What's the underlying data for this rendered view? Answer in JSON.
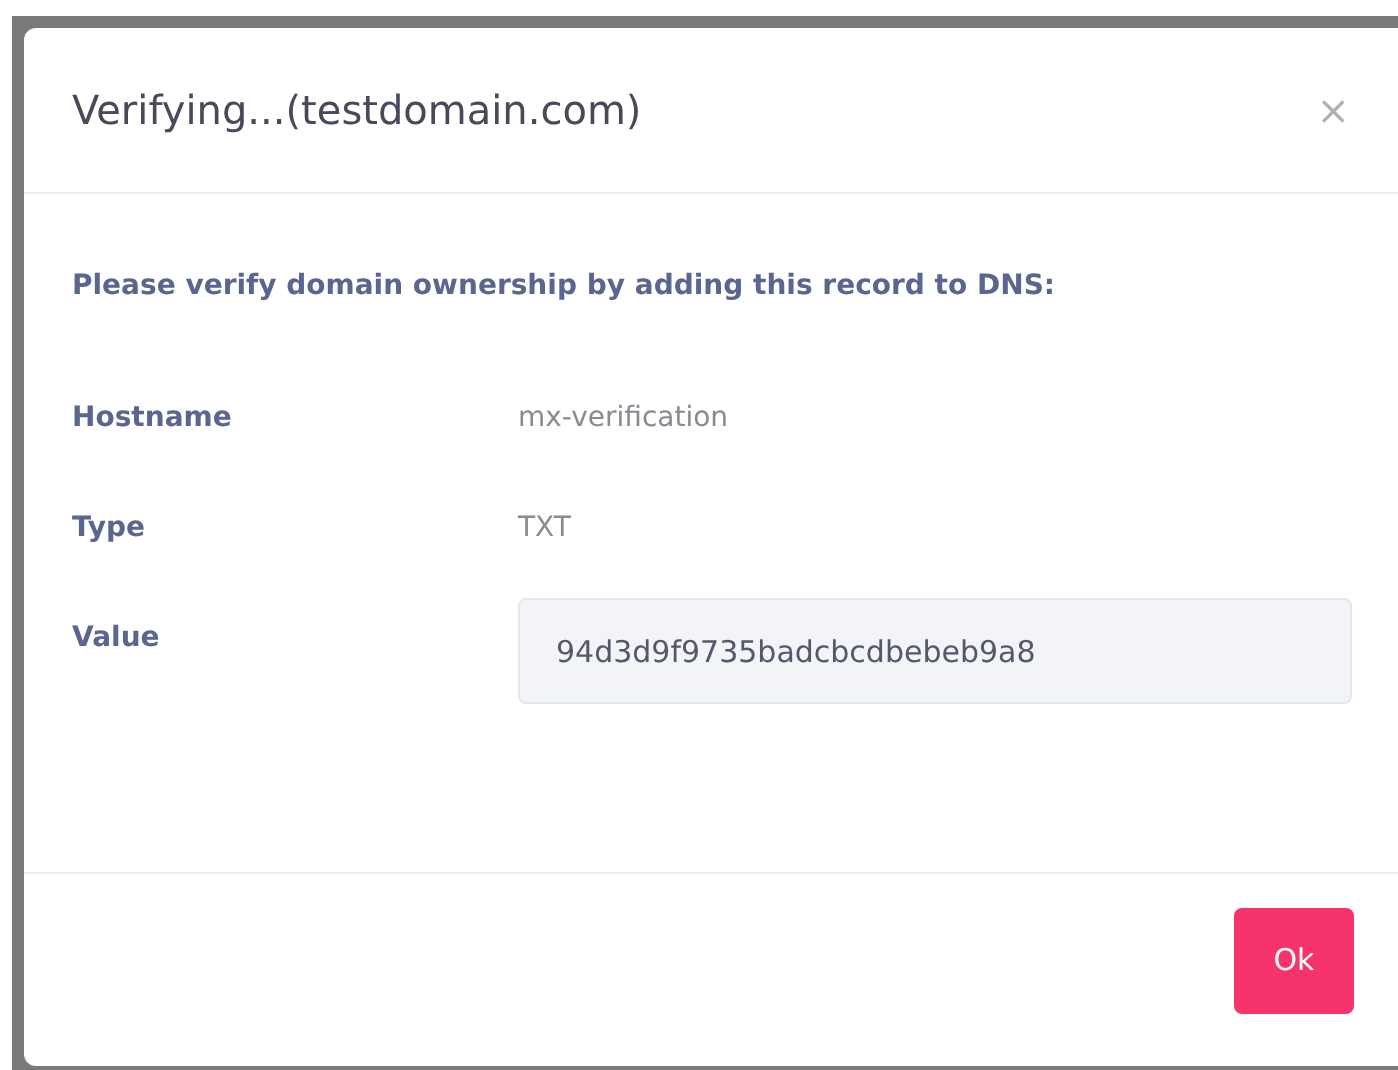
{
  "dialog": {
    "title": "Verifying...(testdomain.com)",
    "close": "×",
    "instruction": "Please verify domain ownership by adding this record to DNS:",
    "fields": [
      {
        "kind": "text",
        "label": "Hostname",
        "value": "mx-verification"
      },
      {
        "kind": "text",
        "label": "Type",
        "value": "TXT"
      },
      {
        "kind": "input",
        "label": "Value",
        "value": "94d3d9f9735badcbcdbebeb9a8"
      }
    ],
    "buttons": [
      "Ok"
    ]
  }
}
